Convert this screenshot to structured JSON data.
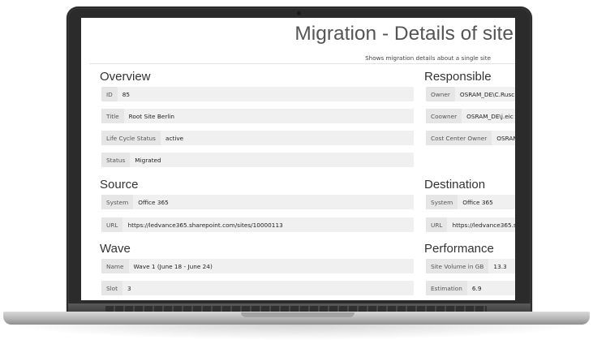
{
  "page": {
    "title": "Migration - Details of site",
    "subtitle": "Shows migration details about a single site"
  },
  "overview": {
    "heading": "Overview",
    "fields": [
      {
        "label": "ID",
        "value": "85"
      },
      {
        "label": "Title",
        "value": "Root Site Berlin"
      },
      {
        "label": "Life Cycle Status",
        "value": "active"
      },
      {
        "label": "Status",
        "value": "Migrated"
      }
    ]
  },
  "responsible": {
    "heading": "Responsible",
    "fields": [
      {
        "label": "Owner",
        "value": "OSRAM_DE\\C.Rusc"
      },
      {
        "label": "Coowner",
        "value": "OSRAM_DE\\j.eic"
      },
      {
        "label": "Cost Center Owner",
        "value": "OSRAN"
      }
    ]
  },
  "source": {
    "heading": "Source",
    "fields": [
      {
        "label": "System",
        "value": "Office 365"
      },
      {
        "label": "URL",
        "value": "https://ledvance365.sharepoint.com/sites/10000113"
      }
    ]
  },
  "destination": {
    "heading": "Destination",
    "fields": [
      {
        "label": "System",
        "value": "Office 365"
      },
      {
        "label": "URL",
        "value": "https://ledvance365.s"
      }
    ]
  },
  "wave": {
    "heading": "Wave",
    "fields": [
      {
        "label": "Name",
        "value": "Wave 1 (June 18 - June 24)"
      },
      {
        "label": "Slot",
        "value": "3"
      }
    ]
  },
  "performance": {
    "heading": "Performance",
    "fields": [
      {
        "label": "Site Volume in GB",
        "value": "13.3"
      },
      {
        "label": "Estimation",
        "value": "6.9"
      }
    ]
  }
}
